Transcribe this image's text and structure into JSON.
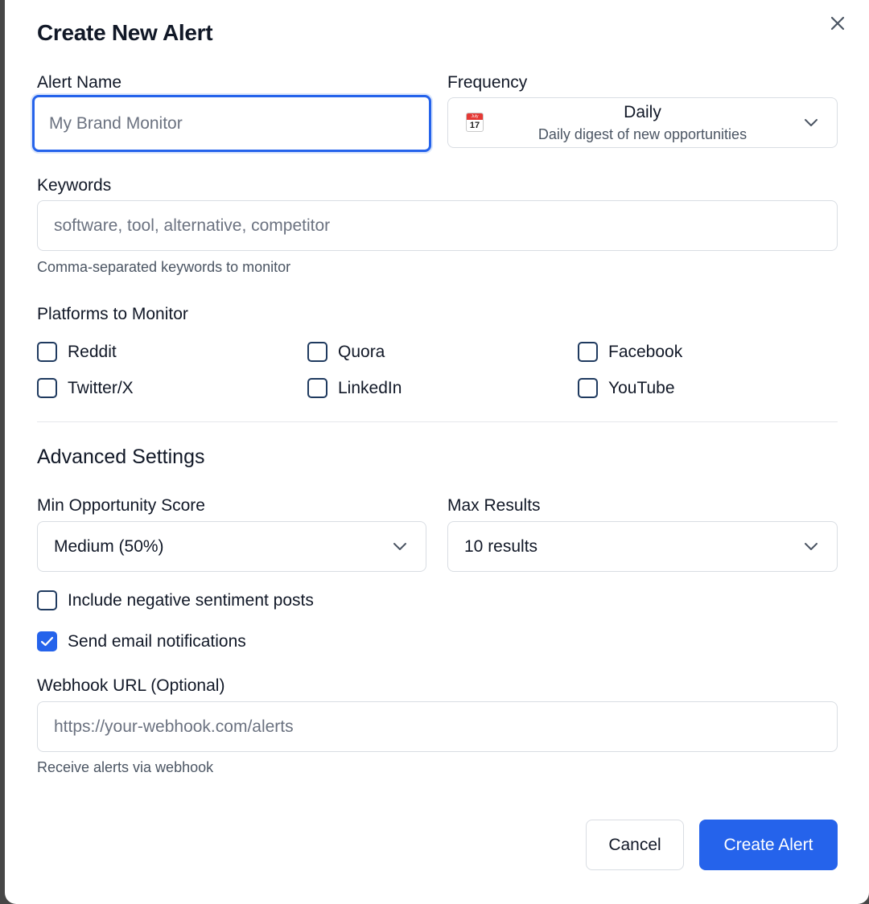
{
  "dialog": {
    "title": "Create New Alert",
    "close_icon": "close-icon"
  },
  "alert_name": {
    "label": "Alert Name",
    "placeholder": "My Brand Monitor",
    "value": ""
  },
  "frequency": {
    "label": "Frequency",
    "icon": "calendar-icon",
    "calendar_month": "July",
    "calendar_day": "17",
    "selected": "Daily",
    "description": "Daily digest of new opportunities"
  },
  "keywords": {
    "label": "Keywords",
    "placeholder": "software, tool, alternative, competitor",
    "value": "",
    "help": "Comma-separated keywords to monitor"
  },
  "platforms": {
    "label": "Platforms to Monitor",
    "items": [
      {
        "label": "Reddit",
        "checked": false
      },
      {
        "label": "Quora",
        "checked": false
      },
      {
        "label": "Facebook",
        "checked": false
      },
      {
        "label": "Twitter/X",
        "checked": false
      },
      {
        "label": "LinkedIn",
        "checked": false
      },
      {
        "label": "YouTube",
        "checked": false
      }
    ]
  },
  "advanced": {
    "title": "Advanced Settings",
    "min_score": {
      "label": "Min Opportunity Score",
      "selected": "Medium (50%)"
    },
    "max_results": {
      "label": "Max Results",
      "selected": "10 results"
    },
    "negative_sentiment": {
      "label": "Include negative sentiment posts",
      "checked": false
    },
    "email_notifications": {
      "label": "Send email notifications",
      "checked": true
    }
  },
  "webhook": {
    "label": "Webhook URL (Optional)",
    "placeholder": "https://your-webhook.com/alerts",
    "value": "",
    "help": "Receive alerts via webhook"
  },
  "buttons": {
    "cancel": "Cancel",
    "create": "Create Alert"
  },
  "colors": {
    "primary": "#2563eb",
    "border": "#d9dde3",
    "text": "#111827",
    "muted": "#4b5563"
  }
}
